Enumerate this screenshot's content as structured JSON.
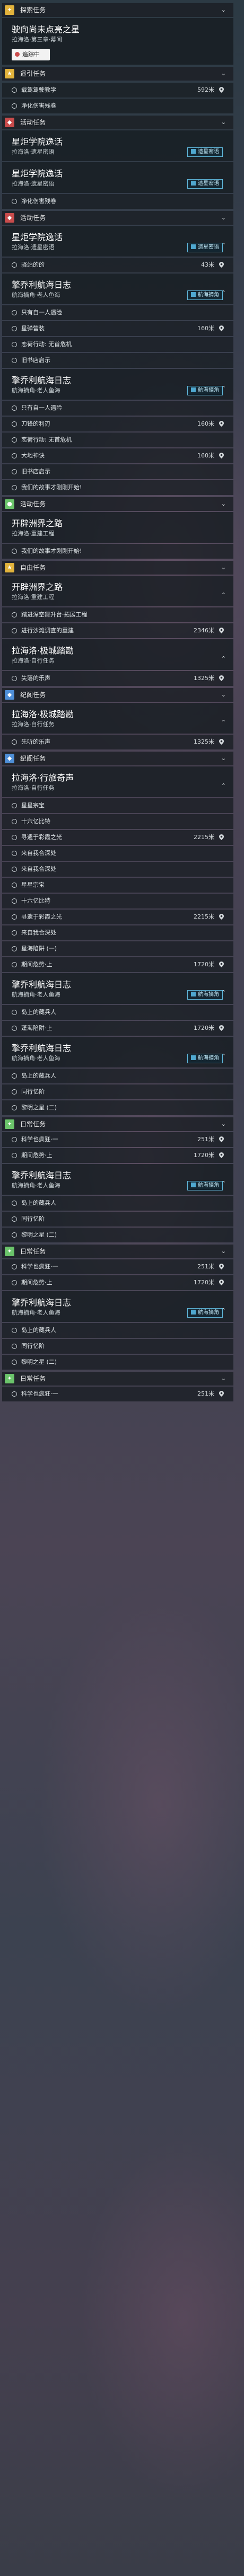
{
  "sections": {
    "tansuo": "探索任务",
    "tansuo_card_title": "驶向尚未点亮之星",
    "tansuo_card_sub": "拉海洛·第三章·幕间",
    "tansuo_btn": "追踪中",
    "yaoqi": "遥引任务",
    "yaoqi_item": "载驾驾驶教学",
    "yaoqi_dist": "592米",
    "yaoqi_item2": "净化伤害残卷",
    "huodong": "活动任务",
    "xing_title": "星炬学院逸话",
    "xing_sub": "拉海洛·遗星密语",
    "xing_tag": "遗星密语",
    "jinghua": "净化伤害残卷",
    "qingqiao": "擎乔利航海日志",
    "qingqiao_sub": "航海摘角·老人鱼海",
    "tag_hanghai": "航海摘角",
    "tiandi_title": "开辟洲界之路",
    "tiandi_sub": "拉海洛·重建工程",
    "ziyou": "自由任务",
    "lahai_title": "拉海洛·极城踏勘",
    "lahai_sub": "拉海洛·自行任务",
    "jiyuan": "纪阁任务",
    "jiyuan_title": "拉海洛·行旅奇声",
    "jiyuan_sub": "拉海洛·自行任务",
    "gelong": "日常任务",
    "ritian": "日常任务"
  },
  "rows": {
    "r1": "驿站的的",
    "r1d": "43米",
    "r2": "只有自一人遇险",
    "r3": "星弹营装",
    "r3d": "160米",
    "r4": "恋荷行动: 无首危机",
    "r5": "旧书店启示",
    "r6": "刀锋的利刃",
    "r6d": "160米",
    "r7": "大地神诀",
    "r8": "我们的故事才刚刚开始!",
    "r9": "踏进深空舞升台·拓展工程",
    "r10": "进行沙滩调查的重建",
    "r10d": "2346米",
    "r11": "失落的乐声",
    "r11d": "1325米",
    "r12": "先听的乐声",
    "r12d": "1325米",
    "r13": "星星宗宝",
    "r14": "十六亿比特",
    "r15": "寻遗于彩霞之光",
    "r15d": "2215米",
    "r16": "来自我合深处",
    "r17": "星海陷阱 (一)",
    "r18": "期间危势·上",
    "r18d": "1720米",
    "r19": "岛上的藏兵人",
    "r20": "蓬海陷阱·上",
    "r20d": "1720米",
    "r21": "同行忆阶",
    "r22": "黎明之星 (二)",
    "r23": "科学也疯狂·一",
    "r23d": "251米"
  },
  "ui": {
    "chevron_up": "⌃",
    "chevron_down": "⌄",
    "pin": "pin"
  }
}
